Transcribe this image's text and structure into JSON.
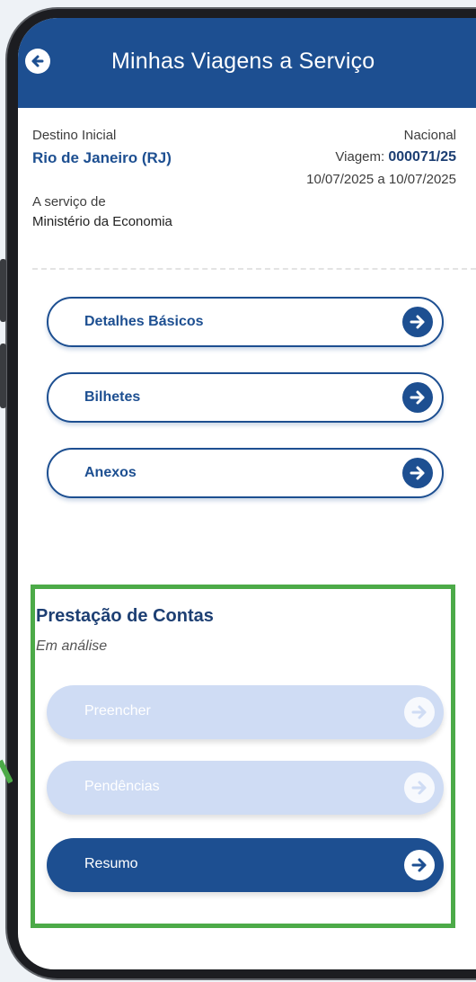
{
  "header": {
    "title": "Minhas Viagens a Serviço"
  },
  "trip": {
    "initial_destination_label": "Destino Inicial",
    "initial_destination": "Rio de Janeiro (RJ)",
    "scope": "Nacional",
    "trip_label": "Viagem:",
    "trip_number": "000071/25",
    "date_range": "10/07/2025 a 10/07/2025",
    "service_of_label": "A serviço de",
    "service_of": "Ministério da Economia"
  },
  "menu": [
    {
      "label": "Detalhes Básicos"
    },
    {
      "label": "Bilhetes"
    },
    {
      "label": "Anexos"
    }
  ],
  "accounts": {
    "title": "Prestação de Contas",
    "status": "Em análise",
    "actions": [
      {
        "label": "Preencher",
        "state": "disabled"
      },
      {
        "label": "Pendências",
        "state": "disabled"
      },
      {
        "label": "Resumo",
        "state": "active"
      }
    ]
  },
  "colors": {
    "primary": "#1d4f91",
    "disabled": "#cfdcf4",
    "highlight": "#4caa48"
  }
}
